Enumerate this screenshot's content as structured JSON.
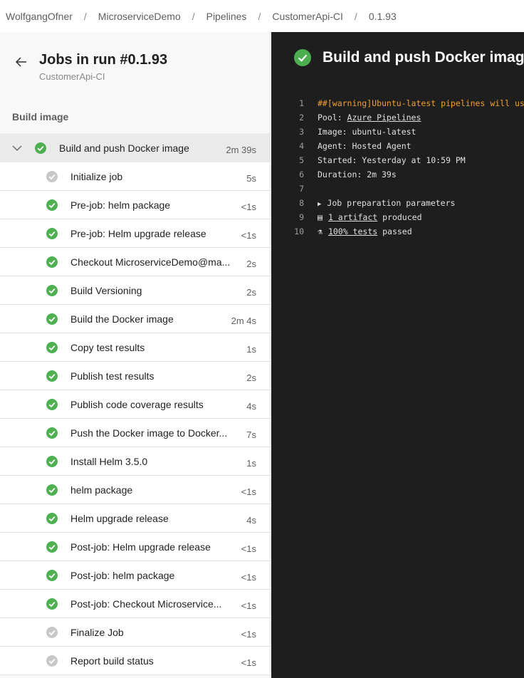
{
  "breadcrumb": [
    "WolfgangOfner",
    "MicroserviceDemo",
    "Pipelines",
    "CustomerApi-CI",
    "0.1.93"
  ],
  "left": {
    "title": "Jobs in run #0.1.93",
    "subtitle": "CustomerApi-CI",
    "stage": "Build image",
    "job": {
      "name": "Build and push Docker image",
      "duration": "2m 39s"
    },
    "steps": [
      {
        "name": "Initialize job",
        "duration": "5s",
        "status": "skipped"
      },
      {
        "name": "Pre-job: helm package",
        "duration": "<1s",
        "status": "success"
      },
      {
        "name": "Pre-job: Helm upgrade release",
        "duration": "<1s",
        "status": "success"
      },
      {
        "name": "Checkout MicroserviceDemo@ma...",
        "duration": "2s",
        "status": "success"
      },
      {
        "name": "Build Versioning",
        "duration": "2s",
        "status": "success"
      },
      {
        "name": "Build the Docker image",
        "duration": "2m 4s",
        "status": "success"
      },
      {
        "name": "Copy test results",
        "duration": "1s",
        "status": "success"
      },
      {
        "name": "Publish test results",
        "duration": "2s",
        "status": "success"
      },
      {
        "name": "Publish code coverage results",
        "duration": "4s",
        "status": "success"
      },
      {
        "name": "Push the Docker image to Docker...",
        "duration": "7s",
        "status": "success"
      },
      {
        "name": "Install Helm 3.5.0",
        "duration": "1s",
        "status": "success"
      },
      {
        "name": "helm package",
        "duration": "<1s",
        "status": "success"
      },
      {
        "name": "Helm upgrade release",
        "duration": "4s",
        "status": "success"
      },
      {
        "name": "Post-job: Helm upgrade release",
        "duration": "<1s",
        "status": "success"
      },
      {
        "name": "Post-job: helm package",
        "duration": "<1s",
        "status": "success"
      },
      {
        "name": "Post-job: Checkout Microservice...",
        "duration": "<1s",
        "status": "success"
      },
      {
        "name": "Finalize Job",
        "duration": "<1s",
        "status": "skipped"
      },
      {
        "name": "Report build status",
        "duration": "<1s",
        "status": "skipped"
      }
    ]
  },
  "right": {
    "title": "Build and push Docker image",
    "log": [
      {
        "n": "1",
        "warn": "##[warning]Ubuntu-latest pipelines will use"
      },
      {
        "n": "2",
        "pre": "Pool: ",
        "link": "Azure Pipelines"
      },
      {
        "n": "3",
        "pre": "Image: ubuntu-latest"
      },
      {
        "n": "4",
        "pre": "Agent: Hosted Agent"
      },
      {
        "n": "5",
        "pre": "Started: Yesterday at 10:59 PM"
      },
      {
        "n": "6",
        "pre": "Duration: 2m 39s"
      },
      {
        "n": "7",
        "pre": ""
      },
      {
        "n": "8",
        "icon": "▶",
        "pre": "Job preparation parameters"
      },
      {
        "n": "9",
        "icon": "artifact-icon",
        "link": "1 artifact",
        "post": " produced"
      },
      {
        "n": "10",
        "icon": "flask-icon",
        "link": "100% tests",
        "post": " passed"
      }
    ]
  },
  "colors": {
    "success": "#4caf50",
    "skipped": "#c8c8c8",
    "warning": "#f0a030",
    "dark_bg": "#1e1e1e"
  }
}
